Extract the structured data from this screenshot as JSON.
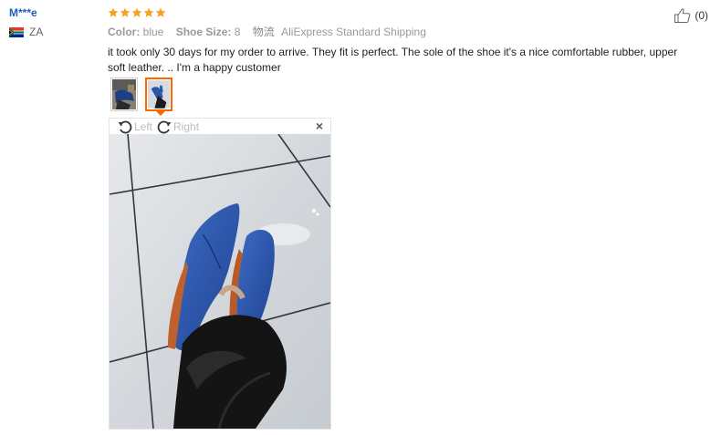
{
  "reviewer": {
    "name": "M***e",
    "country": "ZA",
    "flag_icon": "south-africa-flag-icon"
  },
  "review": {
    "rating": 5,
    "star_color": "#f7a21e",
    "color_label": "Color:",
    "color_value": "blue",
    "size_label": "Shoe Size:",
    "size_value": "8",
    "shipping_label": "物流",
    "shipping_value": "AliExpress Standard Shipping",
    "text": "it took only 30 days for my order to arrive. They fit is perfect. The sole of the shoe it's a nice comfortable rubber, upper soft leather. .. I'm a happy customer"
  },
  "helpful": {
    "icon": "thumbs-up-icon",
    "count": "(0)"
  },
  "thumbnails": [
    {
      "icon": "photo-thumbnail",
      "active": false
    },
    {
      "icon": "photo-thumbnail",
      "active": true
    }
  ],
  "viewer": {
    "rotate_left_label": "Left",
    "rotate_right_label": "Right",
    "close_icon": "close-icon",
    "accent": "#ff6600"
  }
}
